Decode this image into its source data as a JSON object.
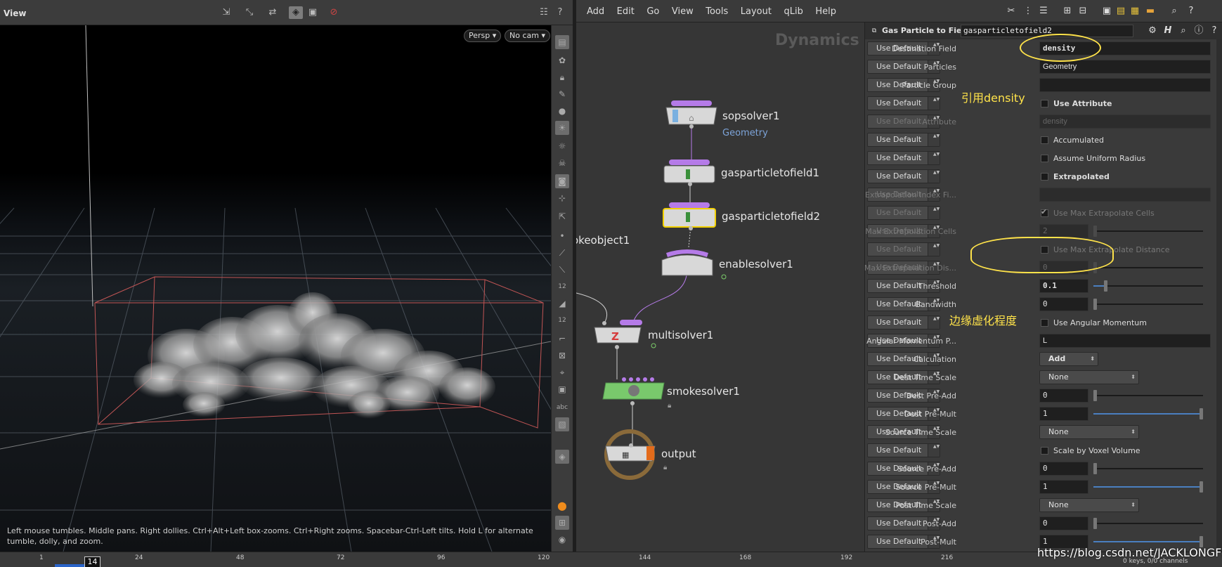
{
  "viewport": {
    "title": "View",
    "camera_view": "Persp",
    "camera_cam": "No cam",
    "help_text": "Left mouse tumbles. Middle pans. Right dollies. Ctrl+Alt+Left box-zooms. Ctrl+Right zooms. Spacebar-Ctrl-Left tilts. Hold L for alternate tumble, dolly, and zoom.",
    "sidebar_labels": [
      "12",
      "12",
      "abc"
    ]
  },
  "menubar": {
    "items": [
      "Add",
      "Edit",
      "Go",
      "View",
      "Tools",
      "Layout",
      "qLib",
      "Help"
    ]
  },
  "network": {
    "context_label": "Dynamics",
    "nodes": [
      {
        "name": "sopsolver1",
        "sub": "Geometry"
      },
      {
        "name": "gasparticletofield1",
        "sub": ""
      },
      {
        "name": "gasparticletofield2",
        "sub": ""
      },
      {
        "name": "okeobject1",
        "sub": ""
      },
      {
        "name": "enablesolver1",
        "sub": ""
      },
      {
        "name": "multisolver1",
        "sub": ""
      },
      {
        "name": "smokesolver1",
        "sub": ""
      },
      {
        "name": "output",
        "sub": ""
      }
    ]
  },
  "params": {
    "node_type": "Gas Particle to Field",
    "node_name": "gasparticletofield2",
    "use_default_label": "Use Default",
    "rows": [
      {
        "label": "Destination Field",
        "kind": "text",
        "value": "density",
        "bold": true
      },
      {
        "label": "Particles",
        "kind": "text",
        "value": "Geometry"
      },
      {
        "label": "Particle Group",
        "kind": "text",
        "value": ""
      },
      {
        "label": "",
        "kind": "check",
        "check_label": "Use Attribute",
        "bold": true
      },
      {
        "label": "Attribute",
        "kind": "text",
        "value": "density",
        "disabled": true
      },
      {
        "label": "",
        "kind": "check",
        "check_label": "Accumulated"
      },
      {
        "label": "",
        "kind": "check",
        "check_label": "Assume Uniform Radius"
      },
      {
        "label": "",
        "kind": "check",
        "check_label": "Extrapolated",
        "bold": true
      },
      {
        "label": "Extrapolation Index Fi...",
        "kind": "text",
        "value": "",
        "disabled": true
      },
      {
        "label": "",
        "kind": "check",
        "check_label": "Use Max Extrapolate Cells",
        "checked": true,
        "disabled": true
      },
      {
        "label": "Max Extrapolation Cells",
        "kind": "num",
        "value": "2",
        "disabled": true,
        "slider": 0
      },
      {
        "label": "",
        "kind": "check",
        "check_label": "Use Max Extrapolate Distance",
        "disabled": true
      },
      {
        "label": "Max Extrapolation Dis...",
        "kind": "num",
        "value": "0",
        "disabled": true,
        "slider": 0
      },
      {
        "label": "Threshold",
        "kind": "num",
        "value": "0.1",
        "bold": true,
        "slider": 0.1
      },
      {
        "label": "Bandwidth",
        "kind": "num",
        "value": "0",
        "slider": 0
      },
      {
        "label": "",
        "kind": "check",
        "check_label": "Use Angular Momentum"
      },
      {
        "label": "Angular Momentum P...",
        "kind": "text",
        "value": "L"
      },
      {
        "label": "Calculation",
        "kind": "dropdown",
        "value": "Add",
        "bold": true
      },
      {
        "label": "Dest Time Scale",
        "kind": "dropdown",
        "value": "None",
        "wide": true
      },
      {
        "label": "Dest Pre-Add",
        "kind": "num",
        "value": "0",
        "slider": 0
      },
      {
        "label": "Dest Pre-Mult",
        "kind": "num",
        "value": "1",
        "slider": 1
      },
      {
        "label": "Source Time Scale",
        "kind": "dropdown",
        "value": "None",
        "wide": true
      },
      {
        "label": "",
        "kind": "check",
        "check_label": "Scale by Voxel Volume"
      },
      {
        "label": "Source Pre-Add",
        "kind": "num",
        "value": "0",
        "slider": 0
      },
      {
        "label": "Source Pre-Mult",
        "kind": "num",
        "value": "1",
        "slider": 1
      },
      {
        "label": "Post Time Scale",
        "kind": "dropdown",
        "value": "None",
        "wide": true
      },
      {
        "label": "Post-Add",
        "kind": "num",
        "value": "0",
        "slider": 0
      },
      {
        "label": "Post-Mult",
        "kind": "num",
        "value": "1",
        "slider": 1
      }
    ],
    "disabled_rows": [
      4,
      8,
      9,
      10,
      11,
      12
    ]
  },
  "annotations": {
    "density_note": "引用density",
    "threshold_note": "边缘虚化程度"
  },
  "timeline": {
    "current_frame": "14",
    "ticks": [
      "1",
      "24",
      "48",
      "72",
      "96",
      "120",
      "144",
      "168",
      "192",
      "216"
    ],
    "keys_status": "0 keys, 0/0 channels",
    "watermark": "https://blog.csdn.net/JACKLONGFX"
  },
  "colors": {
    "accent_blue": "#4a7fc0",
    "annotation_yellow": "#ffe34a",
    "node_purple": "#b57be8",
    "node_selected": "#f2d000",
    "smoke_green": "#79c96c"
  }
}
